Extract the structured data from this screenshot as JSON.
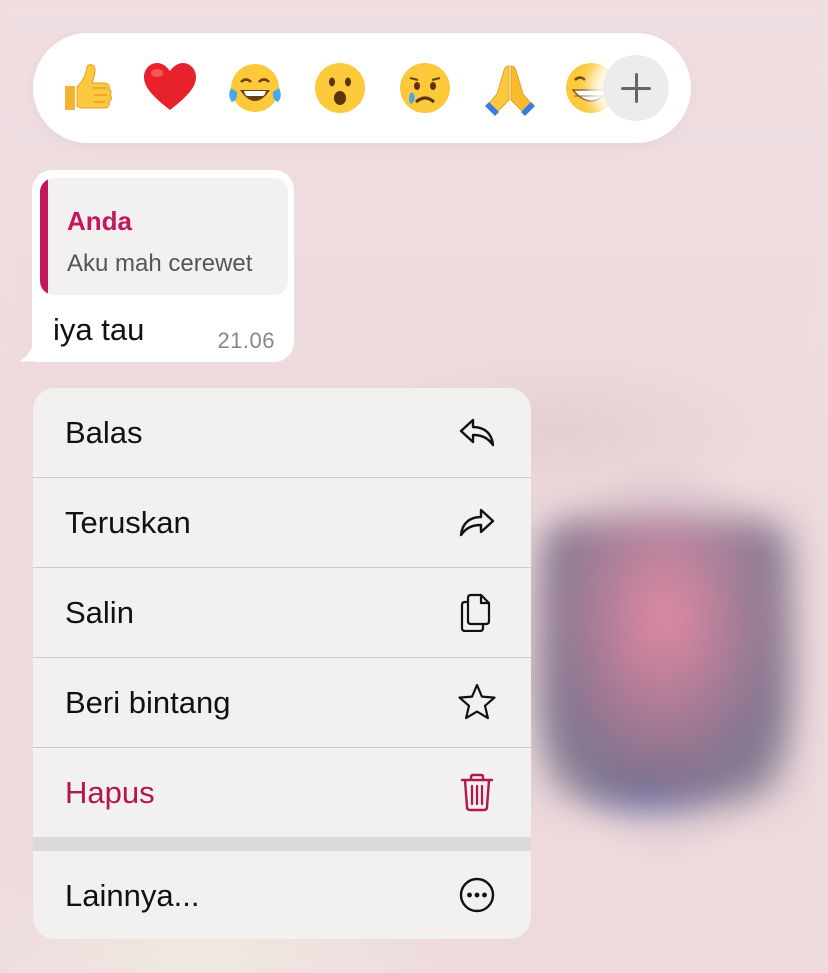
{
  "reactions": {
    "emojis": [
      {
        "name": "thumbs-up",
        "glyph": "👍"
      },
      {
        "name": "red-heart",
        "glyph": "❤️"
      },
      {
        "name": "tears-of-joy",
        "glyph": "😂"
      },
      {
        "name": "surprised",
        "glyph": "😮"
      },
      {
        "name": "crying",
        "glyph": "😢"
      },
      {
        "name": "folded-hands",
        "glyph": "🙏"
      },
      {
        "name": "grinning",
        "glyph": "😁"
      }
    ],
    "more_icon": "plus-icon"
  },
  "message": {
    "quote_author": "Anda",
    "quote_text": "Aku mah cerewet",
    "text": "iya tau",
    "time": "21.06"
  },
  "menu": {
    "items": [
      {
        "label": "Balas",
        "icon": "reply-icon"
      },
      {
        "label": "Teruskan",
        "icon": "forward-icon"
      },
      {
        "label": "Salin",
        "icon": "copy-icon"
      },
      {
        "label": "Beri bintang",
        "icon": "star-icon"
      },
      {
        "label": "Hapus",
        "icon": "trash-icon"
      },
      {
        "label": "Lainnya...",
        "icon": "more-icon"
      }
    ]
  },
  "colors": {
    "accent": "#c2185b",
    "danger": "#b0184a"
  }
}
